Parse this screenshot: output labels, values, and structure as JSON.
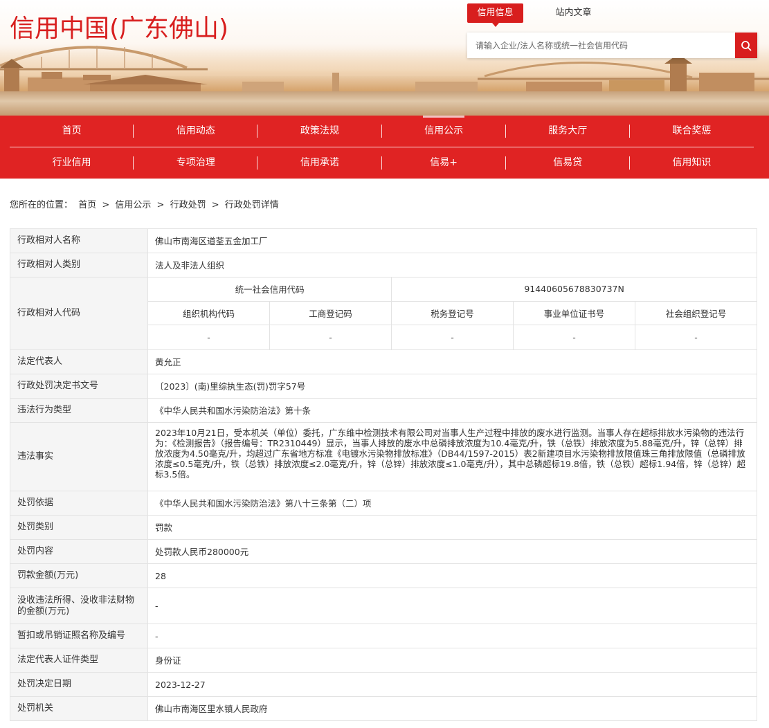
{
  "header": {
    "site_title": "信用中国(广东佛山)",
    "top_tabs": [
      {
        "label": "信用信息",
        "active": true
      },
      {
        "label": "站内文章",
        "active": false
      }
    ],
    "search": {
      "placeholder": "请输入企业/法人名称或统一社会信用代码",
      "value": "",
      "button_icon": "search-icon"
    }
  },
  "nav": {
    "row1": [
      "首页",
      "信用动态",
      "政策法规",
      "信用公示",
      "服务大厅",
      "联合奖惩"
    ],
    "row2": [
      "行业信用",
      "专项治理",
      "信用承诺",
      "信易+",
      "信易贷",
      "信用知识"
    ],
    "active": "信用公示"
  },
  "breadcrumb": {
    "prefix": "您所在的位置：",
    "items": [
      "首页",
      "信用公示",
      "行政处罚",
      "行政处罚详情"
    ],
    "separator": ">"
  },
  "detail": {
    "subject_name": {
      "label": "行政相对人名称",
      "value": "佛山市南海区道荃五金加工厂"
    },
    "subject_type": {
      "label": "行政相对人类别",
      "value": "法人及非法人组织"
    },
    "subject_code": {
      "label": "行政相对人代码",
      "uscc_label": "统一社会信用代码",
      "uscc_value": "91440605678830737N",
      "sub_headers": [
        "组织机构代码",
        "工商登记码",
        "税务登记号",
        "事业单位证书号",
        "社会组织登记号"
      ],
      "sub_values": [
        "-",
        "-",
        "-",
        "-",
        "-"
      ]
    },
    "legal_rep": {
      "label": "法定代表人",
      "value": "黄允正"
    },
    "decision_no": {
      "label": "行政处罚决定书文号",
      "value": "〔2023〕(南)里综执生态(罚)罚字57号"
    },
    "violation_type": {
      "label": "违法行为类型",
      "value": "《中华人民共和国水污染防治法》第十条"
    },
    "facts": {
      "label": "违法事实",
      "value": "2023年10月21日，受本机关（单位）委托，广东维中检测技术有限公司对当事人生产过程中排放的废水进行监测。当事人存在超标排放水污染物的违法行为：《检测报告》（报告编号：TR2310449）显示，当事人排放的废水中总磷排放浓度为10.4毫克/升，铁（总铁）排放浓度为5.88毫克/升，锌（总锌）排放浓度为4.50毫克/升，均超过广东省地方标准《电镀水污染物排放标准》（DB44/1597-2015）表2新建项目水污染物排放限值珠三角排放限值（总磷排放浓度≤0.5毫克/升，铁（总铁）排放浓度≤2.0毫克/升，锌（总锌）排放浓度≤1.0毫克/升），其中总磷超标19.8倍，铁（总铁）超标1.94倍，锌（总锌）超标3.5倍。"
    },
    "basis": {
      "label": "处罚依据",
      "value": "《中华人民共和国水污染防治法》第八十三条第（二）项"
    },
    "category": {
      "label": "处罚类别",
      "value": "罚款"
    },
    "content": {
      "label": "处罚内容",
      "value": "处罚款人民币280000元"
    },
    "fine": {
      "label": "罚款金额(万元)",
      "value": "28"
    },
    "confiscation": {
      "label": "没收违法所得、没收非法财物的金额(万元)",
      "value": "-"
    },
    "license": {
      "label": "暂扣或吊销证照名称及编号",
      "value": "-"
    },
    "id_type": {
      "label": "法定代表人证件类型",
      "value": "身份证"
    },
    "decision_date": {
      "label": "处罚决定日期",
      "value": "2023-12-27"
    },
    "authority": {
      "label": "处罚机关",
      "value": "佛山市南海区里水镇人民政府"
    }
  },
  "colors": {
    "brand_red": "#e02323",
    "title_red": "#d81e1e",
    "label_bg": "#f5f5f5",
    "border": "#e3e3e3"
  }
}
